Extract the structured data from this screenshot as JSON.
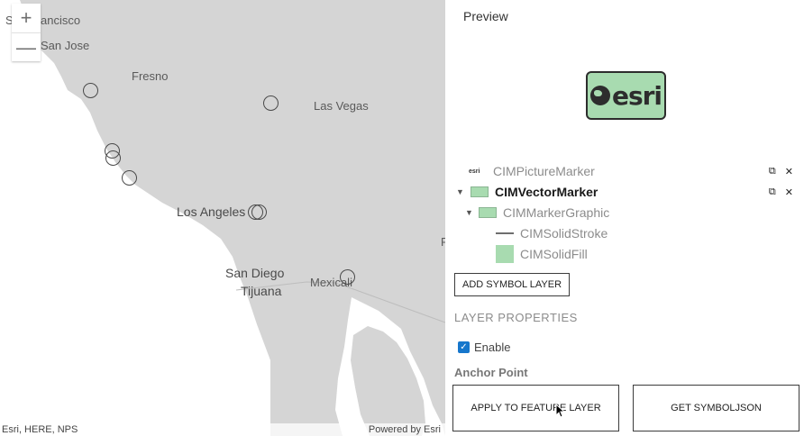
{
  "map": {
    "cities": {
      "san_francisco": "San Francisco",
      "san_jose": "San Jose",
      "fresno": "Fresno",
      "las_vegas": "Las Vegas",
      "los_angeles": "Los Angeles",
      "san_diego": "San Diego",
      "tijuana": "Tijuana",
      "mexicali": "Mexicali",
      "partial_label": "F"
    },
    "zoom": {
      "in": "+",
      "out": "—"
    },
    "attribution_left": "Esri, HERE, NPS",
    "attribution_right": "Powered by Esri"
  },
  "panel": {
    "preview_title": "Preview",
    "preview_logo_text": "esri",
    "tiny_logo_text": "esri",
    "layers": [
      {
        "label": "CIMPictureMarker"
      },
      {
        "label": "CIMVectorMarker"
      },
      {
        "label": "CIMMarkerGraphic"
      },
      {
        "label": "CIMSolidStroke"
      },
      {
        "label": "CIMSolidFill"
      }
    ],
    "row_actions": {
      "duplicate": "⧉",
      "remove": "✕"
    },
    "add_symbol_layer_label": "ADD SYMBOL LAYER",
    "layer_properties_header": "LAYER PROPERTIES",
    "enable_label": "Enable",
    "enable_checked": true,
    "anchor_point_label": "Anchor Point",
    "apply_button_label": "APPLY TO FEATURE LAYER",
    "get_json_button_label": "GET SYMBOLJSON"
  },
  "colors": {
    "marker_fill": "#a8dbb0",
    "checkbox_blue": "#1677cc",
    "map_land": "#d5d5d5",
    "map_water": "#ffffff"
  }
}
